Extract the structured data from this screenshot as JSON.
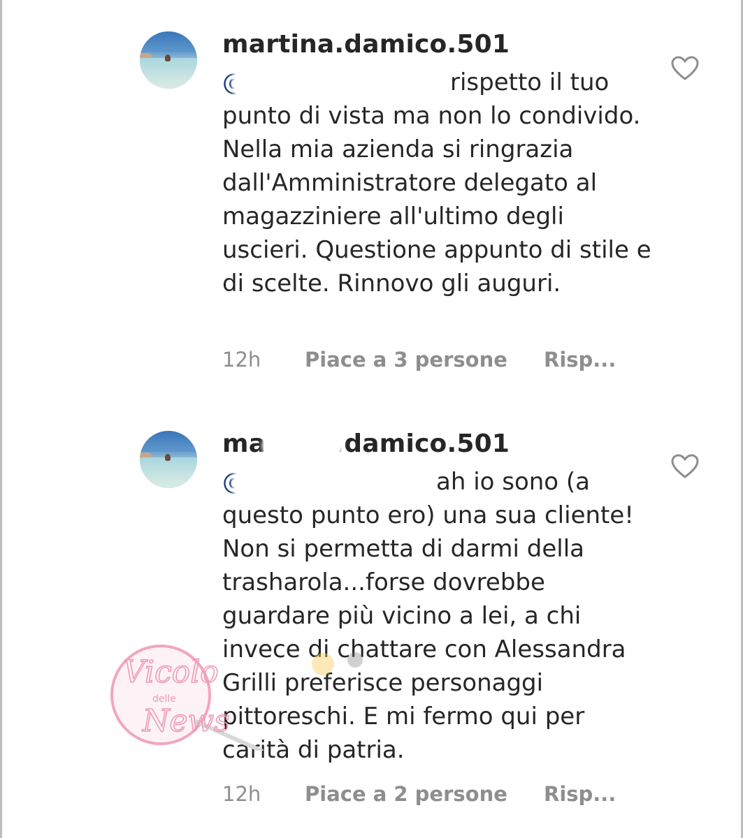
{
  "comments": [
    {
      "username": "martina.damico.501",
      "mention": "@",
      "text": "rispetto il tuo punto di vista ma non lo condivido. Nella mia azienda si ringrazia dall'Amministratore delegato al magazziniere all'ultimo degli uscieri. Questione appunto di stile e di scelte. Rinnovo gli auguri.",
      "time": "12h",
      "likes": "Piace a 3 persone",
      "reply": "Risp..."
    },
    {
      "username": "martina.damico.501",
      "mention": "@",
      "text": "ah io sono (a questo punto ero) una sua cliente! Non si permetta di darmi della trasharola...forse dovrebbe guardare più vicino a lei, a chi invece di chattare con Alessandra Grilli preferisce personaggi pittoreschi. E mi fermo qui per carità di patria.",
      "time": "12h",
      "likes": "Piace a 2 persone",
      "reply": "Risp..."
    }
  ],
  "watermark": {
    "line1": "Vicolo",
    "line2": "delle",
    "line3": "News"
  },
  "colors": {
    "text": "#262626",
    "meta": "#8e8e8e",
    "mention": "#143d7a",
    "watermark": "#f2a5c0"
  },
  "icons": {
    "like": "heart-outline-icon",
    "avatar": "profile-photo-pool"
  }
}
